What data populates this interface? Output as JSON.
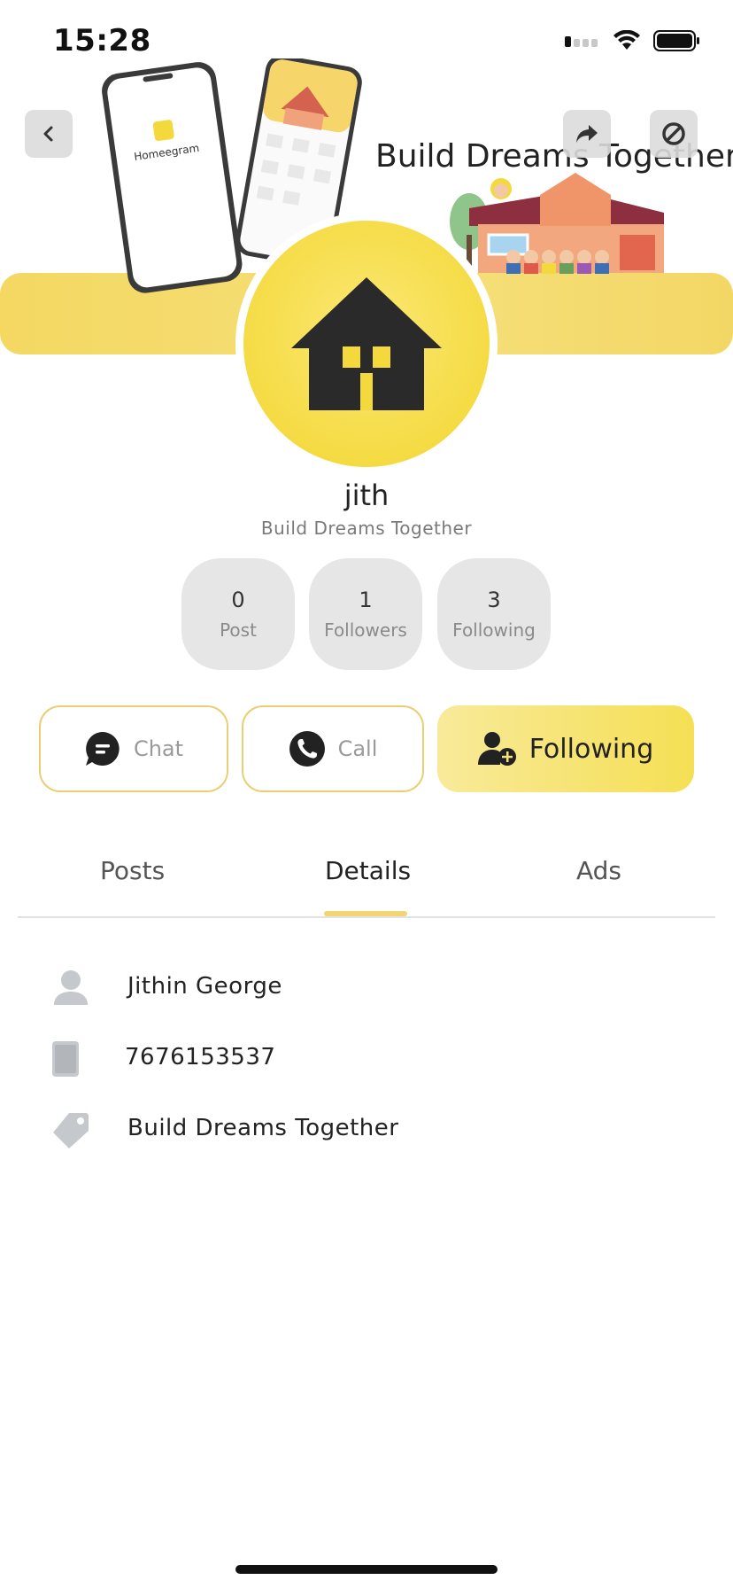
{
  "status_bar": {
    "time": "15:28",
    "signal_icon": "signal-icon",
    "wifi_icon": "wifi-icon",
    "battery_icon": "battery-icon"
  },
  "banner": {
    "title": "Build Dreams Together",
    "phone_app_name": "Homeegram",
    "colors": {
      "band": "#f4d862"
    }
  },
  "nav": {
    "back_icon": "chevron-left-icon",
    "share_icon": "share-icon",
    "block_icon": "block-icon"
  },
  "profile": {
    "avatar_icon": "house-logo-icon",
    "name": "jith",
    "tagline": "Build Dreams Together"
  },
  "stats": [
    {
      "value": "0",
      "label": "Post"
    },
    {
      "value": "1",
      "label": "Followers"
    },
    {
      "value": "3",
      "label": "Following"
    }
  ],
  "actions": {
    "chat_label": "Chat",
    "call_label": "Call",
    "follow_label": "Following"
  },
  "tabs": [
    {
      "label": "Posts"
    },
    {
      "label": "Details",
      "active": true
    },
    {
      "label": "Ads"
    }
  ],
  "details": {
    "name": "Jithin George",
    "phone": "7676153537",
    "tag": "Build Dreams Together"
  },
  "colors": {
    "accent": "#f4d93d",
    "button_border": "#e9cf73",
    "icon_gray": "#c5c8cc"
  }
}
